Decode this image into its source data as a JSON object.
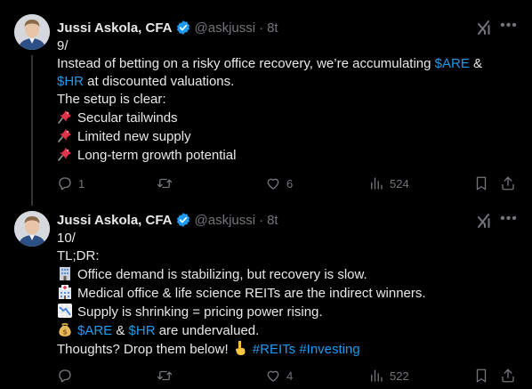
{
  "tweets": [
    {
      "name": "Jussi Askola, CFA",
      "handle": "@askjussi",
      "dot": "·",
      "time": "8t",
      "lines": [
        [
          {
            "t": "9/"
          }
        ],
        [
          {
            "t": "Instead of betting on a risky office recovery, we’re accumulating "
          },
          {
            "t": "$ARE",
            "link": true
          },
          {
            "t": " &"
          }
        ],
        [
          {
            "t": "$HR",
            "link": true
          },
          {
            "t": " at discounted valuations."
          }
        ],
        [
          {
            "t": "The setup is clear:"
          }
        ],
        [
          {
            "emoji": "pushpin"
          },
          {
            "t": "Secular tailwinds"
          }
        ],
        [
          {
            "emoji": "pushpin"
          },
          {
            "t": "Limited new supply"
          }
        ],
        [
          {
            "emoji": "pushpin"
          },
          {
            "t": "Long-term growth potential"
          }
        ]
      ],
      "replies": "1",
      "retweets": "",
      "likes": "6",
      "views": "524"
    },
    {
      "name": "Jussi Askola, CFA",
      "handle": "@askjussi",
      "dot": "·",
      "time": "8t",
      "lines": [
        [
          {
            "t": "10/"
          }
        ],
        [
          {
            "t": "TL;DR:"
          }
        ],
        [
          {
            "emoji": "office"
          },
          {
            "t": "Office demand is stabilizing, but recovery is slow."
          }
        ],
        [
          {
            "emoji": "hospital"
          },
          {
            "t": "Medical office & life science REITs are the indirect winners."
          }
        ],
        [
          {
            "emoji": "chart-down"
          },
          {
            "t": "Supply is shrinking = pricing power rising."
          }
        ],
        [
          {
            "emoji": "moneybag"
          },
          {
            "t": "$ARE",
            "link": true
          },
          {
            "t": " & "
          },
          {
            "t": "$HR",
            "link": true
          },
          {
            "t": " are undervalued."
          }
        ],
        [
          {
            "t": "Thoughts? Drop them below! "
          },
          {
            "emoji": "point-down"
          },
          {
            "t": "#REITs",
            "link": true
          },
          {
            "t": " "
          },
          {
            "t": "#Investing",
            "link": true
          }
        ]
      ],
      "replies": "",
      "retweets": "",
      "likes": "4",
      "views": "522"
    }
  ],
  "colors": {
    "background": "#000000",
    "text": "#e7e9ea",
    "muted": "#71767b",
    "link": "#1d9bf0",
    "verified": "#1d9bf0"
  }
}
